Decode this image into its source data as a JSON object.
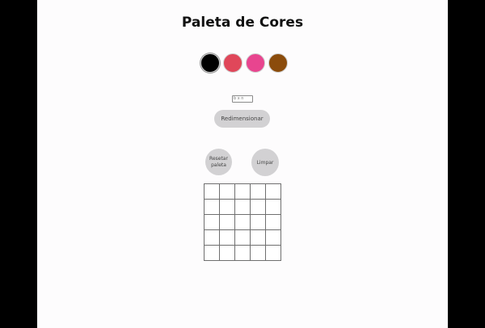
{
  "header": {
    "title": "Paleta de Cores"
  },
  "palette": {
    "colors": [
      {
        "name": "black",
        "hex": "#000000",
        "selected": true
      },
      {
        "name": "red",
        "hex": "#e0475a",
        "selected": false
      },
      {
        "name": "pink",
        "hex": "#e8458f",
        "selected": false
      },
      {
        "name": "brown",
        "hex": "#8b4c0c",
        "selected": false
      }
    ]
  },
  "controls": {
    "size_placeholder": "b x n",
    "size_value": "",
    "resize_label": "Redimensionar",
    "reset_label": "Resetar paleta",
    "clear_label": "Limpar"
  },
  "board": {
    "rows": 5,
    "cols": 5,
    "pixel_color": "#ffffff"
  }
}
